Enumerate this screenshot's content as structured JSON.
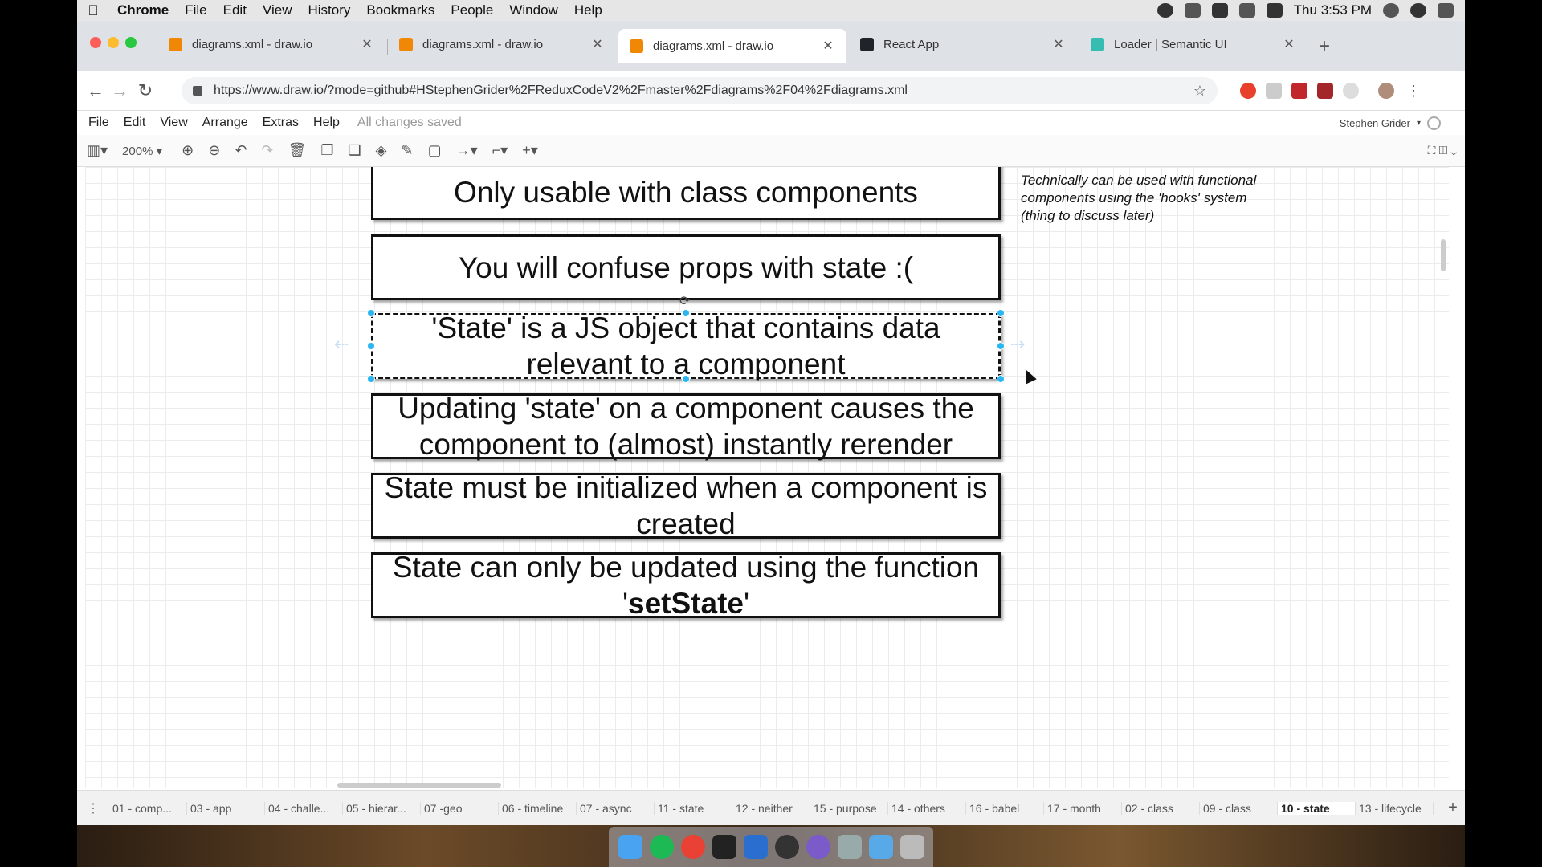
{
  "menubar": {
    "app": "Chrome",
    "items": [
      "File",
      "Edit",
      "View",
      "History",
      "Bookmarks",
      "People",
      "Window",
      "Help"
    ],
    "clock": "Thu 3:53 PM"
  },
  "browser": {
    "tabs": [
      {
        "title": "diagrams.xml - draw.io",
        "icon": "drawio-icon"
      },
      {
        "title": "diagrams.xml - draw.io",
        "icon": "drawio-icon"
      },
      {
        "title": "diagrams.xml - draw.io",
        "icon": "drawio-icon",
        "active": true
      },
      {
        "title": "React App",
        "icon": "react-icon"
      },
      {
        "title": "Loader | Semantic UI",
        "icon": "semantic-icon"
      }
    ],
    "url": "https://www.draw.io/?mode=github#HStephenGrider%2FReduxCodeV2%2Fmaster%2Fdiagrams%2F04%2Fdiagrams.xml"
  },
  "drawio": {
    "menu": [
      "File",
      "Edit",
      "View",
      "Arrange",
      "Extras",
      "Help"
    ],
    "status": "All changes saved",
    "user": "Stephen Grider",
    "zoom": "200%",
    "note": "Technically can be used with functional components using the 'hooks' system (thing to discuss later)",
    "boxes": [
      {
        "text": "Only usable with class components"
      },
      {
        "text": "You will confuse props with state :("
      },
      {
        "text": "'State' is a JS object that contains data relevant to a component",
        "selected": true
      },
      {
        "text": "Updating 'state' on a component causes the component to (almost) instantly rerender"
      },
      {
        "text": "State must be initialized when a component is created"
      },
      {
        "text_before": "State can only be updated using the function '",
        "text_bold": "setState",
        "text_after": "'"
      }
    ],
    "pages": [
      "01 - comp...",
      "03 - app",
      "04 - challe...",
      "05 - hierar...",
      "07 -geo",
      "06 - timeline",
      "07 - async",
      "11 - state",
      "12 - neither",
      "15 - purpose",
      "14 - others",
      "16 - babel",
      "17 - month",
      "02 - class",
      "09 - class",
      "10 - state",
      "13 - lifecycle"
    ],
    "active_page": "10 - state"
  },
  "colors": {
    "selection_handle": "#29b6f2",
    "drawio_orange": "#f08705"
  }
}
